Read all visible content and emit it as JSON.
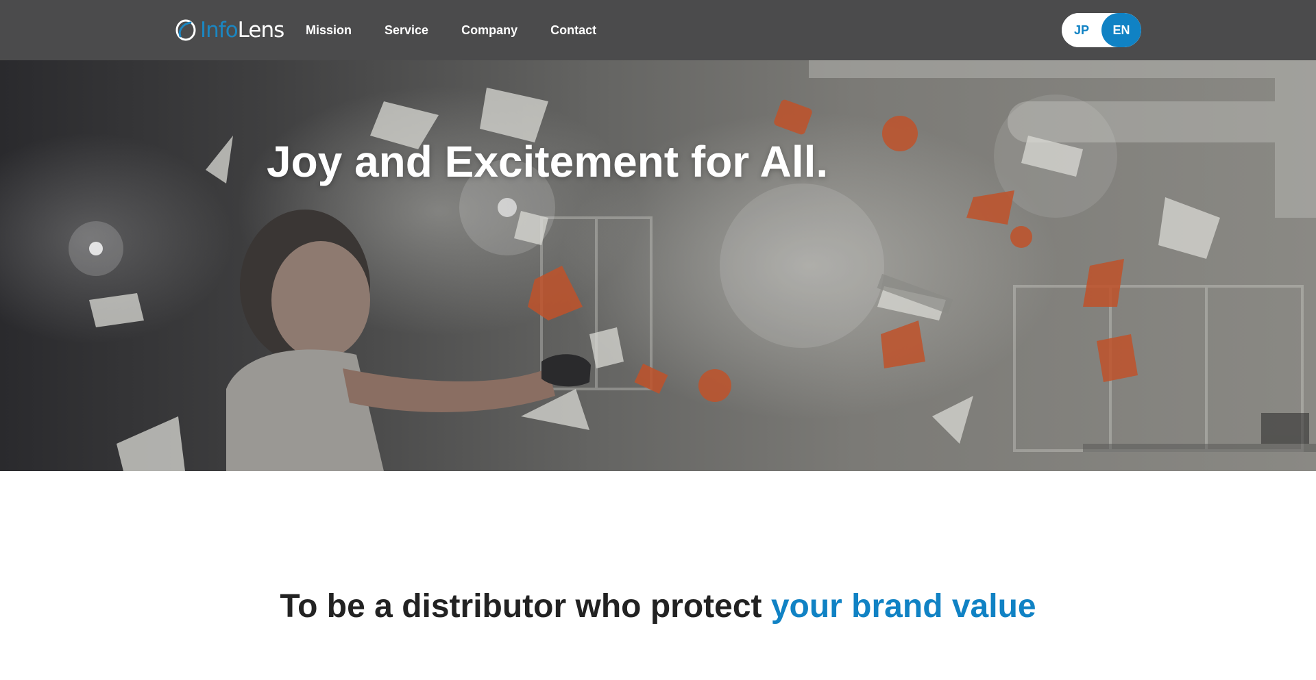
{
  "header": {
    "logo": {
      "text_a": "Info",
      "text_b": "Lens",
      "icon": "lens-ring-icon"
    },
    "nav": [
      {
        "label": "Mission"
      },
      {
        "label": "Service"
      },
      {
        "label": "Company"
      },
      {
        "label": "Contact"
      }
    ],
    "language": {
      "options": [
        "JP",
        "EN"
      ],
      "selected": "EN"
    }
  },
  "hero": {
    "title": "Joy and Excitement for All."
  },
  "mission": {
    "heading_plain": "To be a distributor who protect ",
    "heading_accent": "your brand value"
  },
  "colors": {
    "header_bg": "#4b4b4c",
    "accent": "#1082c4",
    "heading_text": "#222222",
    "hero_object_accent": "#c0522a"
  }
}
